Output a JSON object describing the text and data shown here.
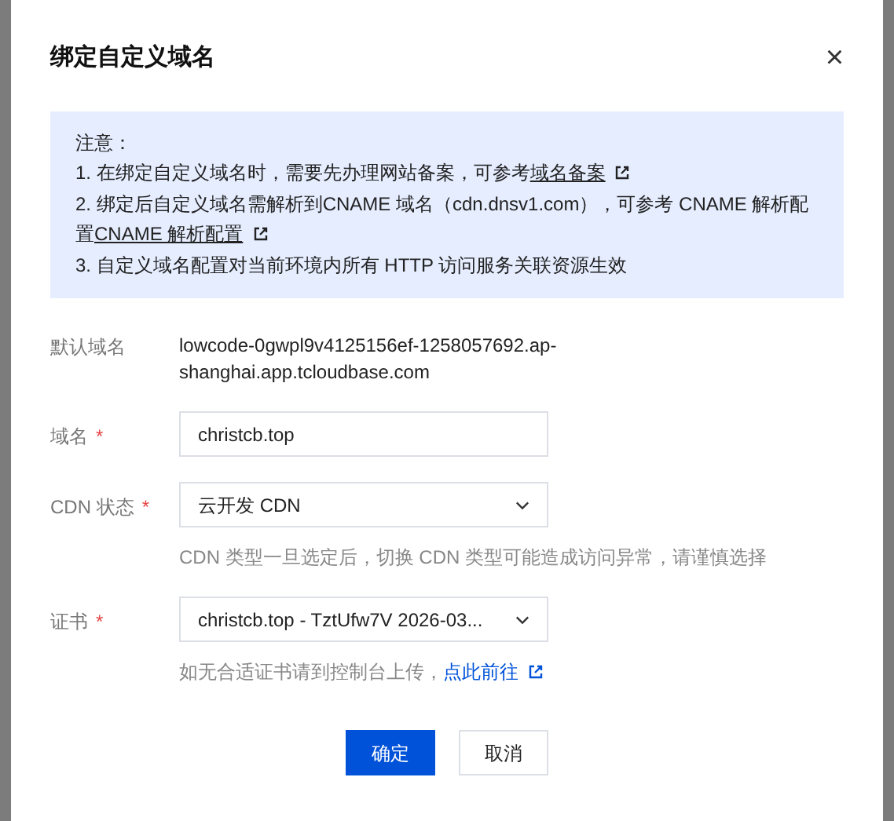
{
  "dialog": {
    "title": "绑定自定义域名",
    "close": "×"
  },
  "notice": {
    "title": "注意：",
    "lines": [
      {
        "text": "1. 在绑定自定义域名时，需要先办理网站备案，可参考",
        "link": "域名备案"
      },
      {
        "text": "2. 绑定后自定义域名需解析到CNAME 域名（cdn.dnsv1.com），可参考 CNAME 解析配置",
        "link": "CNAME 解析配置"
      },
      {
        "text": "3. 自定义域名配置对当前环境内所有 HTTP 访问服务关联资源生效"
      }
    ]
  },
  "fields": [
    {
      "kind": "text",
      "label": "默认域名",
      "value": "lowcode-0gwpl9v4125156ef-1258057692.ap-shanghai.app.tcloudbase.com"
    },
    {
      "kind": "input",
      "label": "域名",
      "required_mark": "*",
      "value": "christcb.top"
    },
    {
      "kind": "select",
      "label": "CDN 状态",
      "required_mark": "*",
      "value": "云开发 CDN",
      "hint": "CDN 类型一旦选定后，切换 CDN 类型可能造成访问异常，请谨慎选择"
    },
    {
      "kind": "select",
      "label": "证书",
      "required_mark": "*",
      "value": "christcb.top - TztUfw7V 2026-03...",
      "hint": "如无合适证书请到控制台上传，",
      "hint_link": "点此前往"
    }
  ],
  "buttons": [
    {
      "label": "确定",
      "primary": true
    },
    {
      "label": "取消",
      "primary": false
    }
  ]
}
